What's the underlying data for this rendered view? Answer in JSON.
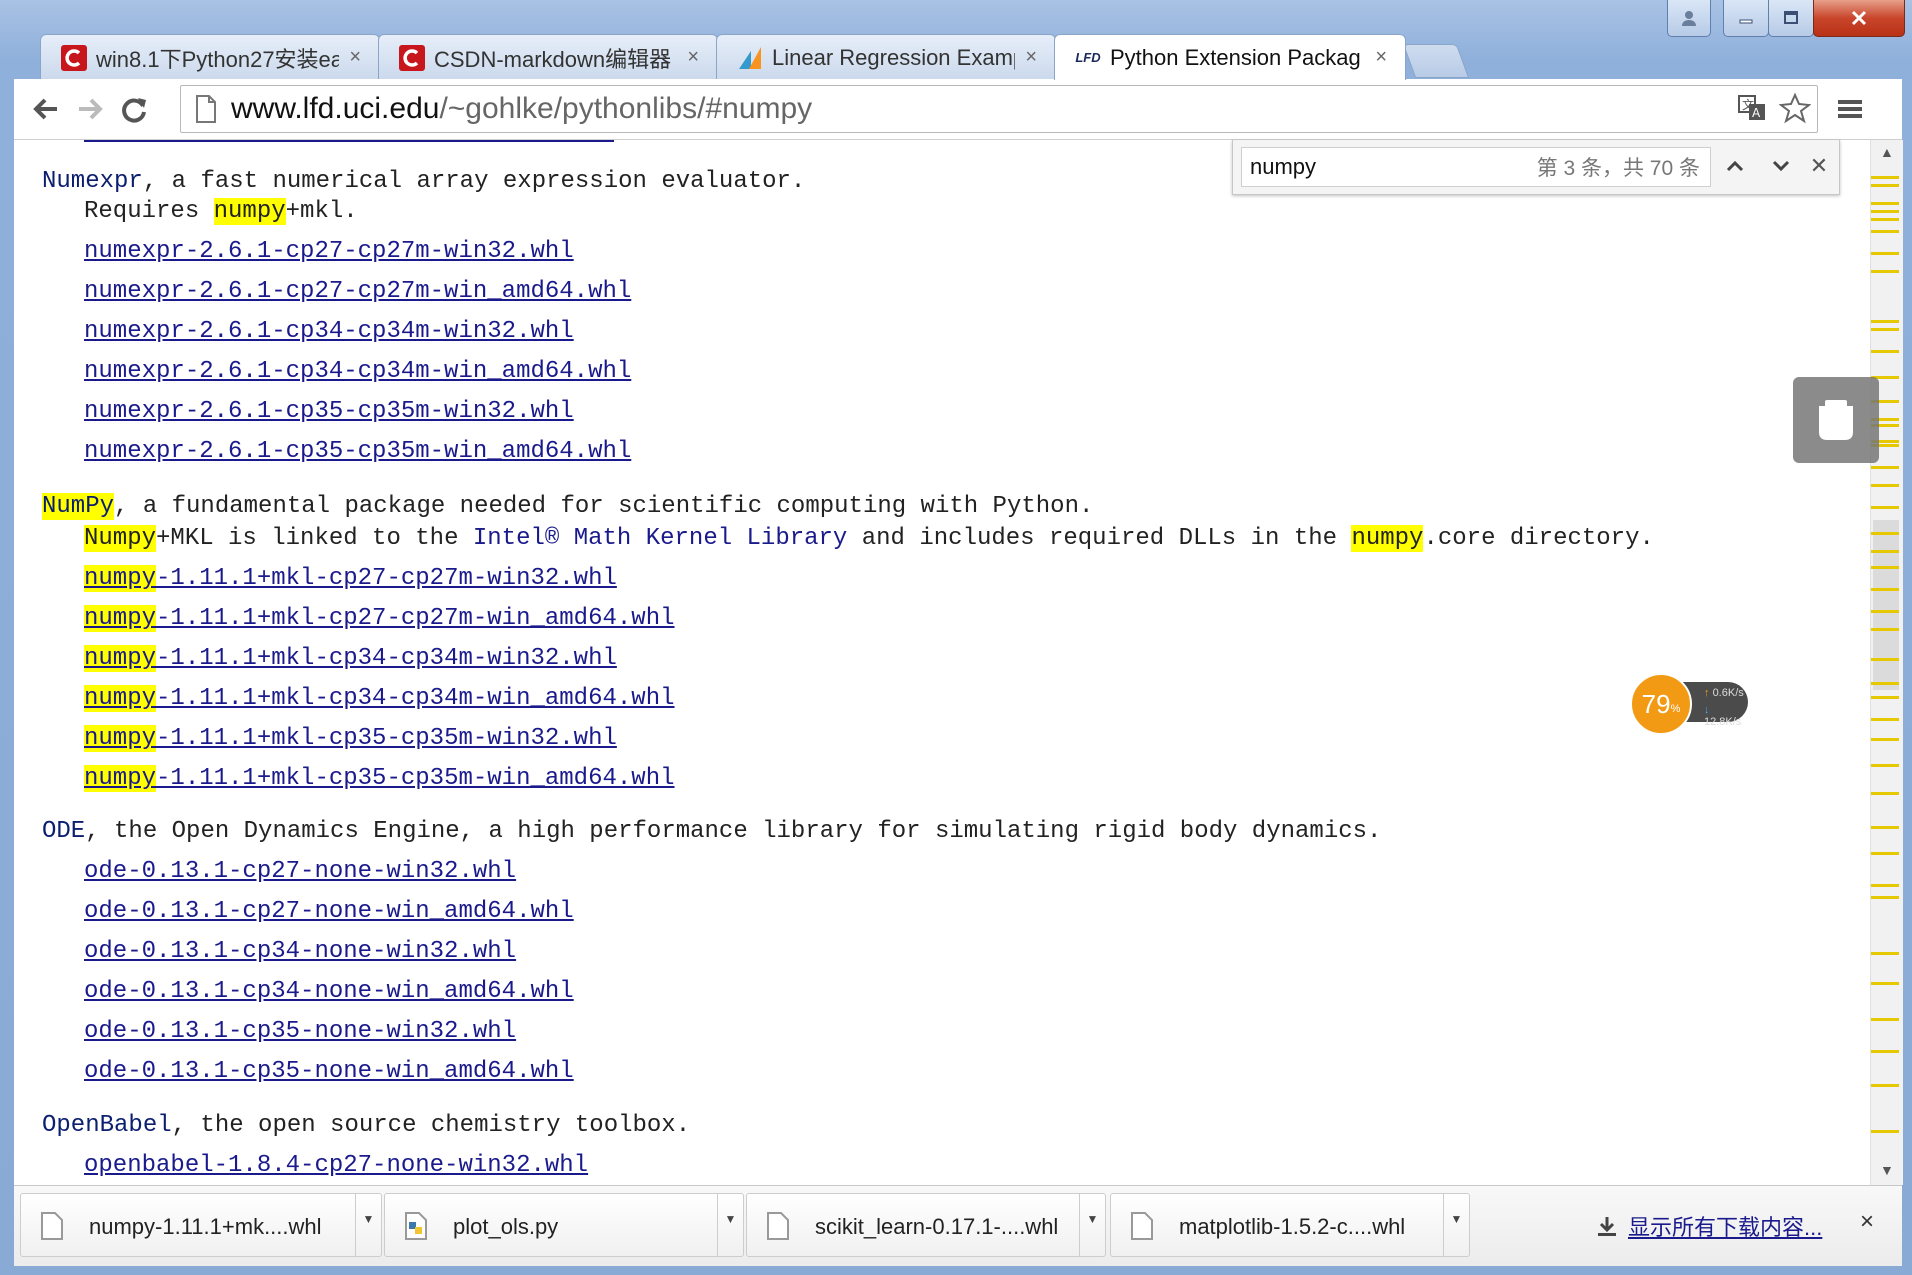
{
  "tabs": [
    {
      "title": "win8.1下Python27安装ea",
      "favicon": "csdn-icon",
      "close": "×"
    },
    {
      "title": "CSDN-markdown编辑器",
      "favicon": "csdn-icon",
      "close": "×"
    },
    {
      "title": "Linear Regression Examp",
      "favicon": "scikit-icon",
      "close": "×"
    },
    {
      "title": "Python Extension Packag",
      "favicon": "lfd-icon",
      "close": "×"
    }
  ],
  "lfd_favicon_text": "LFD",
  "url": {
    "host": "www.lfd.uci.edu",
    "path": "/~gohlke/pythonlibs/#numpy"
  },
  "find": {
    "query": "numpy",
    "count": "第 3 条，共 70 条",
    "close": "✕"
  },
  "sections": {
    "numexpr": {
      "name": "Numexpr",
      "desc": ", a fast numerical array expression evaluator.",
      "req_pre": "Requires ",
      "req_hl": "numpy",
      "req_post": "+mkl.",
      "links": [
        "numexpr‑2.6.1‑cp27‑cp27m‑win32.whl",
        "numexpr‑2.6.1‑cp27‑cp27m‑win_amd64.whl",
        "numexpr‑2.6.1‑cp34‑cp34m‑win32.whl",
        "numexpr‑2.6.1‑cp34‑cp34m‑win_amd64.whl",
        "numexpr‑2.6.1‑cp35‑cp35m‑win32.whl",
        "numexpr‑2.6.1‑cp35‑cp35m‑win_amd64.whl"
      ]
    },
    "numpy": {
      "name": "NumPy",
      "desc": ", a fundamental package needed for scientific computing with Python.",
      "note_hl1": "Numpy",
      "note_a": "+MKL is linked to the ",
      "note_intel": "Intel® Math Kernel Library",
      "note_b": " and includes required DLLs in the ",
      "note_hl2": "numpy",
      "note_c": ".core directory.",
      "link_hl": "numpy",
      "links": [
        "‑1.11.1+mkl‑cp27‑cp27m‑win32.whl",
        "‑1.11.1+mkl‑cp27‑cp27m‑win_amd64.whl",
        "‑1.11.1+mkl‑cp34‑cp34m‑win32.whl",
        "‑1.11.1+mkl‑cp34‑cp34m‑win_amd64.whl",
        "‑1.11.1+mkl‑cp35‑cp35m‑win32.whl",
        "‑1.11.1+mkl‑cp35‑cp35m‑win_amd64.whl"
      ]
    },
    "ode": {
      "name": "ODE",
      "desc": ", the Open Dynamics Engine, a high performance library for simulating rigid body dynamics.",
      "links": [
        "ode‑0.13.1‑cp27‑none‑win32.whl",
        "ode‑0.13.1‑cp27‑none‑win_amd64.whl",
        "ode‑0.13.1‑cp34‑none‑win32.whl",
        "ode‑0.13.1‑cp34‑none‑win_amd64.whl",
        "ode‑0.13.1‑cp35‑none‑win32.whl",
        "ode‑0.13.1‑cp35‑none‑win_amd64.whl"
      ]
    },
    "openbabel": {
      "name": "OpenBabel",
      "desc": ", the open source chemistry toolbox.",
      "links": [
        "openbabel‑1.8.4‑cp27‑none‑win32.whl"
      ]
    }
  },
  "speed_widget": {
    "percent": "79",
    "percent_sign": "%",
    "up": "0.6K/s",
    "down": "12.8K/s"
  },
  "downloads": [
    {
      "name": "numpy-1.11.1+mk....whl",
      "icon": "file-icon"
    },
    {
      "name": "plot_ols.py",
      "icon": "python-file-icon"
    },
    {
      "name": "scikit_learn-0.17.1-....whl",
      "icon": "file-icon"
    },
    {
      "name": "matplotlib-1.5.2-c....whl",
      "icon": "file-icon"
    }
  ],
  "show_all_downloads": "显示所有下载内容...",
  "shelf_close": "×",
  "colors": {
    "highlight": "#ffff00",
    "link": "#1a1a8c",
    "find_tick": "#e6c800",
    "speed": "#f39a15"
  }
}
